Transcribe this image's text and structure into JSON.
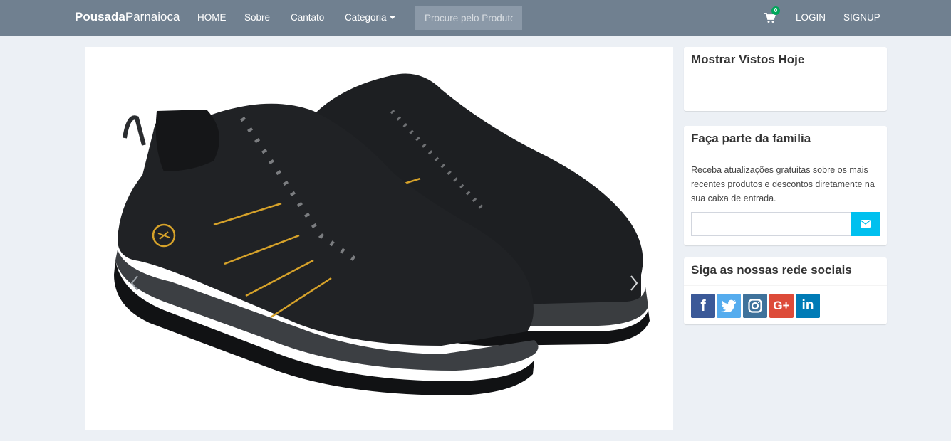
{
  "navbar": {
    "brand_bold": "Pousada",
    "brand_light": "Parnaioca",
    "links": [
      {
        "label": "HOME"
      },
      {
        "label": "Sobre"
      },
      {
        "label": "Cantato"
      },
      {
        "label": "Categoria"
      }
    ],
    "search_placeholder": "Procure pelo Produto",
    "cart_count": "0",
    "login": "LOGIN",
    "signup": "SIGNUP"
  },
  "carousel": {
    "product_image": "black-hiking-boots"
  },
  "sidebar": {
    "viewed_today": {
      "title": "Mostrar Vistos Hoje"
    },
    "newsletter": {
      "title": "Faça parte da familia",
      "text": "Receba atualizações gratuitas sobre os mais recentes produtos e descontos diretamente na sua caixa de entrada.",
      "email_value": "",
      "button_icon": "envelope-icon"
    },
    "social": {
      "title": "Siga as nossas rede sociais",
      "networks": [
        {
          "name": "facebook-icon",
          "glyph": "f",
          "color": "#3b5998"
        },
        {
          "name": "twitter-icon",
          "glyph": "t",
          "color": "#55acee"
        },
        {
          "name": "instagram-icon",
          "glyph": "ig",
          "color": "#3f729b"
        },
        {
          "name": "google-plus-icon",
          "glyph": "G+",
          "color": "#dd4b39"
        },
        {
          "name": "linkedin-icon",
          "glyph": "in",
          "color": "#007bb6"
        }
      ]
    }
  },
  "colors": {
    "navbar": "#708090",
    "page_bg": "#ecf0f5",
    "accent": "#00c0ef",
    "badge": "#00a65a"
  }
}
